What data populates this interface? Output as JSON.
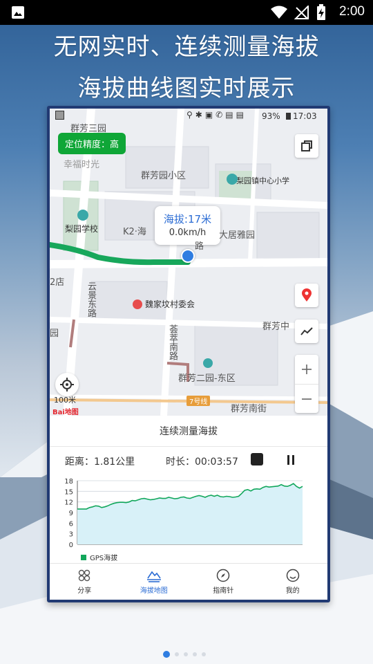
{
  "status_bar": {
    "time": "2:00"
  },
  "headline": {
    "line1": "无网实时、连续测量海拔",
    "line2": "海拔曲线图实时展示"
  },
  "phone": {
    "status_bar": {
      "battery": "93%",
      "time": "17:03"
    },
    "map": {
      "accuracy_pill": "定位精度：高",
      "bubble_altitude": "海拔:17米",
      "bubble_speed": "0.0km/h",
      "scale_label": "100米",
      "baidu_logo_text": "Bai地图",
      "metro_label": "7号线",
      "labels": [
        "群芳三园",
        "幸福时光",
        "群芳园小区",
        "梨园镇中心小学",
        "梨园学校",
        "K2·海",
        "大居雅园",
        "云景东路",
        "魏家坟村委会",
        "群芳中",
        "荟萃南路",
        "群芳二园-东区",
        "群芳南街",
        "2店",
        "园",
        "路"
      ]
    },
    "panel": {
      "title": "连续测量海拔",
      "distance": "距离：1.81公里",
      "duration": "时长：00:03:57"
    },
    "tabs": [
      {
        "label": "分享",
        "icon": "share-grid-icon",
        "active": false
      },
      {
        "label": "海拔地图",
        "icon": "altitude-map-icon",
        "active": true
      },
      {
        "label": "指南针",
        "icon": "compass-icon",
        "active": false
      },
      {
        "label": "我的",
        "icon": "profile-icon",
        "active": false
      }
    ]
  },
  "chart_data": {
    "type": "area",
    "title": "",
    "xlabel": "",
    "ylabel": "",
    "ylim": [
      0,
      18
    ],
    "yticks": [
      0,
      3,
      6,
      9,
      12,
      15,
      18
    ],
    "series": [
      {
        "name": "GPS海拔",
        "color": "#11a75b",
        "fill": "#d8f1f8",
        "values": [
          10.0,
          10.0,
          10.0,
          10.0,
          10.4,
          10.6,
          10.9,
          10.8,
          10.4,
          10.6,
          10.9,
          11.3,
          11.6,
          11.8,
          11.9,
          11.9,
          11.8,
          12.0,
          12.4,
          12.3,
          12.6,
          12.9,
          13.0,
          12.8,
          12.6,
          12.7,
          12.9,
          13.1,
          13.0,
          13.0,
          13.3,
          13.1,
          12.9,
          13.0,
          13.3,
          13.4,
          13.1,
          13.0,
          13.3,
          13.6,
          13.8,
          13.6,
          13.3,
          13.7,
          13.9,
          13.6,
          13.9,
          13.5,
          13.4,
          13.6,
          13.5,
          13.3,
          13.4,
          13.6,
          14.4,
          15.3,
          15.5,
          15.1,
          15.6,
          15.7,
          15.6,
          16.1,
          16.4,
          16.2,
          16.3,
          16.4,
          16.5,
          16.9,
          16.5,
          16.4,
          16.7,
          17.2,
          16.4,
          15.9,
          16.4
        ]
      }
    ]
  }
}
